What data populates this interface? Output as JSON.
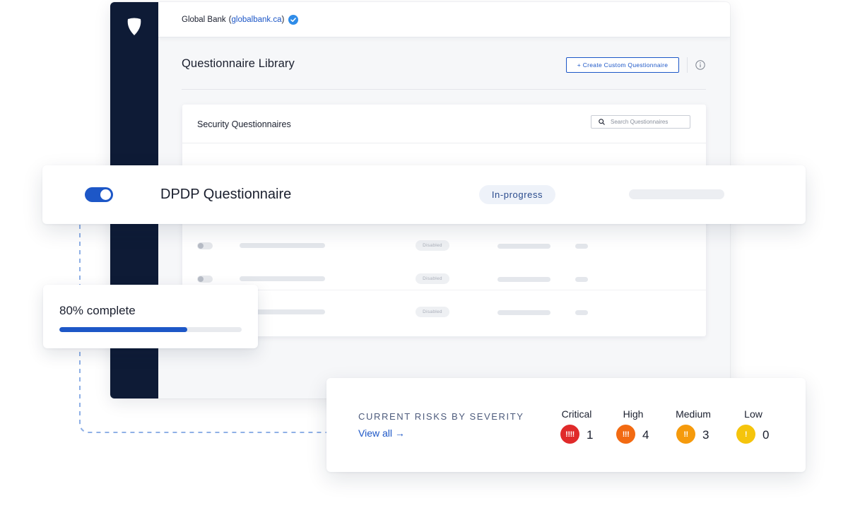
{
  "header": {
    "org_name": "Global Bank",
    "domain_open": "(",
    "domain": "globalbank.ca",
    "domain_close": ")"
  },
  "page": {
    "title": "Questionnaire Library",
    "create_button": "+ Create Custom Questionnaire"
  },
  "security_panel": {
    "title": "Security Questionnaires",
    "search_placeholder": "Search Questionnaires",
    "rows": [
      {
        "status": "Disabled"
      },
      {
        "status": "Disabled"
      },
      {
        "status": "Disabled"
      }
    ]
  },
  "featured": {
    "name": "DPDP Questionnaire",
    "status": "In-progress",
    "enabled": true
  },
  "progress": {
    "label": "80% complete",
    "fraction": 0.7
  },
  "risks": {
    "title": "CURRENT RISKS BY SEVERITY",
    "view_all": "View all →",
    "levels": [
      {
        "label": "Critical",
        "glyph": "!!!!",
        "count": "1",
        "color": "#e02a2a"
      },
      {
        "label": "High",
        "glyph": "!!!",
        "count": "4",
        "color": "#f26a12"
      },
      {
        "label": "Medium",
        "glyph": "!!",
        "count": "3",
        "color": "#f59a0c"
      },
      {
        "label": "Low",
        "glyph": "!",
        "count": "0",
        "color": "#f5c40c"
      }
    ]
  },
  "colors": {
    "accent": "#1d57c7",
    "sidebar": "#0e1b36"
  }
}
